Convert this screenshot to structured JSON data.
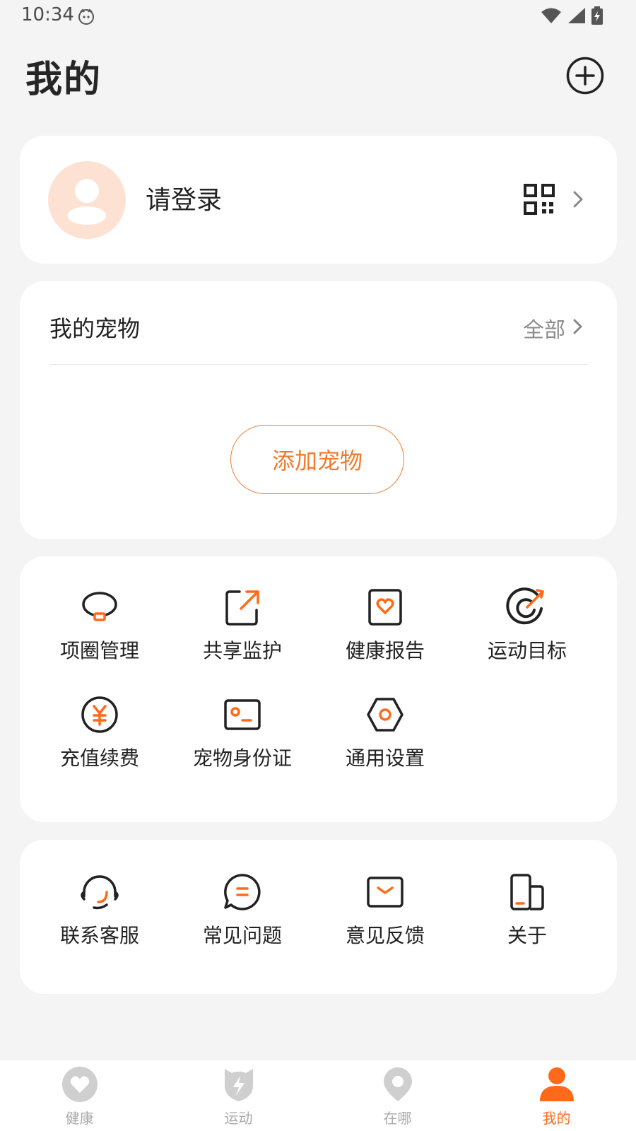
{
  "status_bar": {
    "time": "10:34"
  },
  "header": {
    "title": "我的"
  },
  "profile": {
    "login_prompt": "请登录"
  },
  "pets": {
    "title": "我的宠物",
    "view_all": "全部",
    "add_button": "添加宠物"
  },
  "features": {
    "items": [
      {
        "label": "项圈管理",
        "icon": "collar-icon"
      },
      {
        "label": "共享监护",
        "icon": "share-icon"
      },
      {
        "label": "健康报告",
        "icon": "health-report-icon"
      },
      {
        "label": "运动目标",
        "icon": "target-icon"
      },
      {
        "label": "充值续费",
        "icon": "yuan-icon"
      },
      {
        "label": "宠物身份证",
        "icon": "id-card-icon"
      },
      {
        "label": "通用设置",
        "icon": "settings-icon"
      }
    ]
  },
  "support": {
    "items": [
      {
        "label": "联系客服",
        "icon": "headset-icon"
      },
      {
        "label": "常见问题",
        "icon": "faq-chat-icon"
      },
      {
        "label": "意见反馈",
        "icon": "feedback-mail-icon"
      },
      {
        "label": "关于",
        "icon": "about-icon"
      }
    ]
  },
  "tabbar": {
    "items": [
      {
        "label": "健康",
        "icon": "heart-icon"
      },
      {
        "label": "运动",
        "icon": "sport-shield-icon"
      },
      {
        "label": "在哪",
        "icon": "location-pin-icon"
      },
      {
        "label": "我的",
        "icon": "person-icon",
        "active": true
      }
    ]
  },
  "colors": {
    "accent": "#ff6a1a",
    "background": "#f4f4f4",
    "card": "#ffffff",
    "avatar_bg": "#fde2d4",
    "inactive": "#cfcfcf"
  }
}
